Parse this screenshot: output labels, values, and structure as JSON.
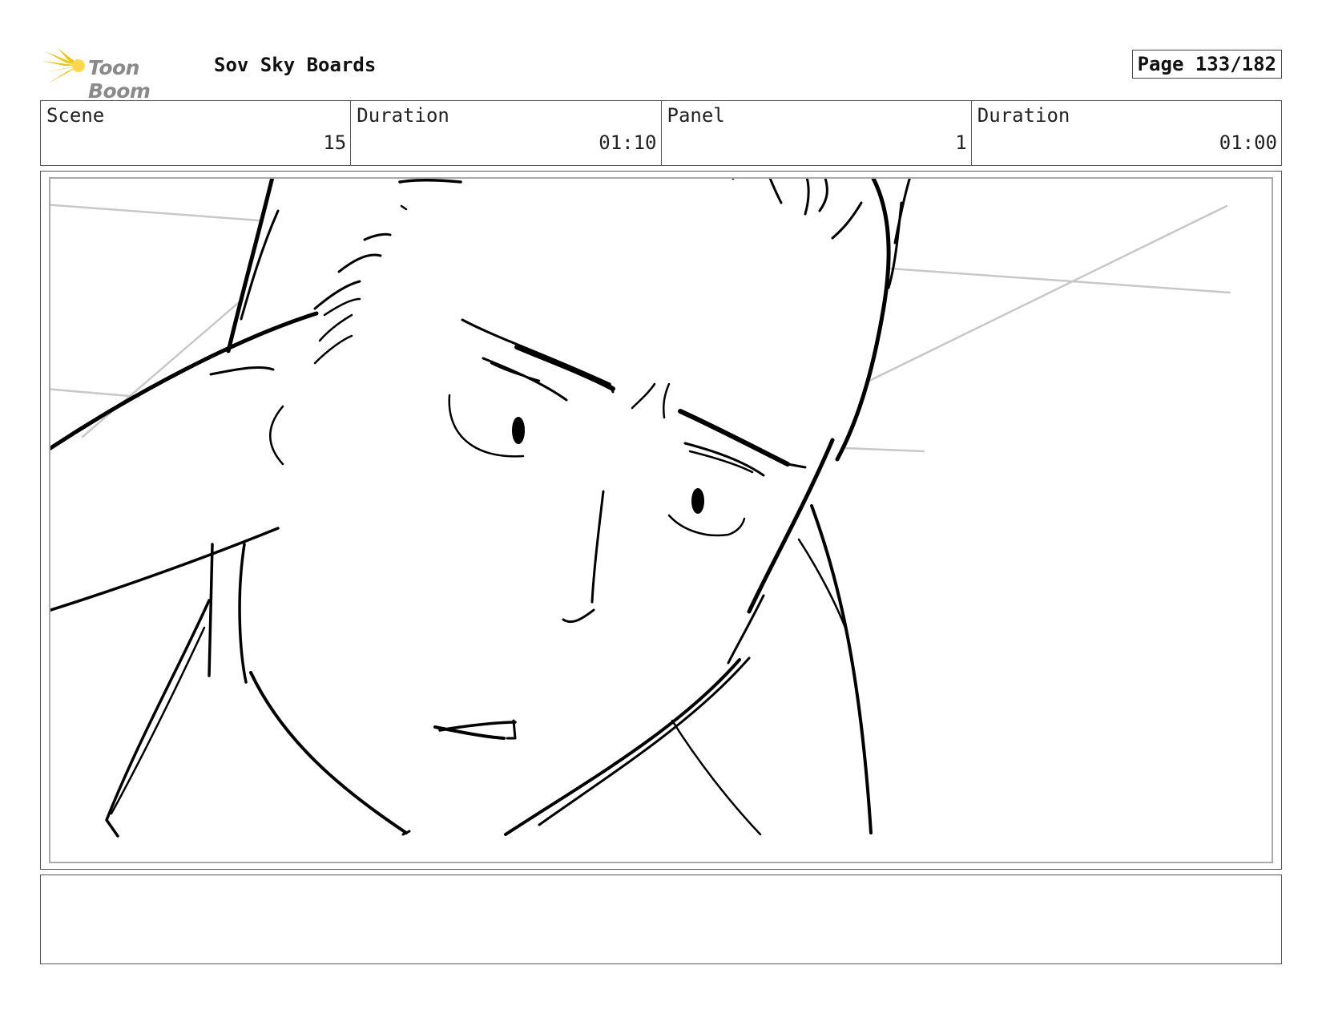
{
  "header": {
    "logo_text": "Toon Boom",
    "project_title": "Sov Sky Boards",
    "page_label": "Page 133/182"
  },
  "info": {
    "scene_label": "Scene",
    "scene_value": "15",
    "scene_duration_label": "Duration",
    "scene_duration_value": "01:10",
    "panel_label": "Panel",
    "panel_value": "1",
    "panel_duration_label": "Duration",
    "panel_duration_value": "01:00"
  },
  "colors": {
    "logo_star": "#f5c400",
    "logo_text": "#8a8a8a",
    "sketch_line": "#000000",
    "guide_line": "#c8c8c8"
  },
  "notes": {
    "text": ""
  }
}
